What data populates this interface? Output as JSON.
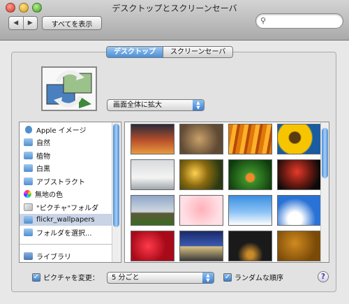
{
  "window": {
    "title": "デスクトップとスクリーンセーバ"
  },
  "toolbar": {
    "back_label": "◀",
    "forward_label": "▶",
    "show_all_label": "すべてを表示",
    "search_placeholder": "",
    "search_icon": "search-icon"
  },
  "tabs": [
    {
      "label": "デスクトップ",
      "active": true
    },
    {
      "label": "スクリーンセーバ",
      "active": false
    }
  ],
  "desktop": {
    "fit_label": "画面全体に拡大",
    "source_list": [
      {
        "label": "Apple イメージ",
        "icon": "apple-icon"
      },
      {
        "label": "自然",
        "icon": "folder-icon"
      },
      {
        "label": "植物",
        "icon": "folder-icon"
      },
      {
        "label": "白黒",
        "icon": "folder-icon"
      },
      {
        "label": "アブストラクト",
        "icon": "folder-icon"
      },
      {
        "label": "無地の色",
        "icon": "colors-icon"
      },
      {
        "label": "\"ピクチャ\"フォルダ",
        "icon": "pictures-folder-icon"
      },
      {
        "label": "flickr_wallpapers",
        "icon": "folder-icon",
        "selected": true
      },
      {
        "label": "フォルダを選択...",
        "icon": "folder-icon"
      }
    ],
    "library_label": "ライブラリ",
    "thumbnails": [
      {
        "name": "sunset-wallpaper",
        "bg": "linear-gradient(#2a2a3a, #b9502a 55%, #e89b40)"
      },
      {
        "name": "bird-wallpaper",
        "bg": "radial-gradient(circle at 45% 50%, #c9a06a, #5f4a34 70%)"
      },
      {
        "name": "orange-rays-wallpaper",
        "bg": "repeating-linear-gradient(100deg, #e0790a 0 6px, #ffb02a 6px 12px, #b34b05 12px 16px)"
      },
      {
        "name": "sunflower-wallpaper",
        "bg": "radial-gradient(circle at 40% 45%, #5a3a10 0 18%, #f7c400 22% 55%, #1a5ca0 60%)"
      },
      {
        "name": "chairs-wallpaper",
        "bg": "linear-gradient(#d8dadb, #f4f4f4 60%, #9fa7ab)"
      },
      {
        "name": "flower-field-wallpaper",
        "bg": "radial-gradient(circle at 35% 45%, #ffd050, #8a6a10 40%, #2b3a12 80%)"
      },
      {
        "name": "green-leaf-wallpaper",
        "bg": "radial-gradient(circle at 50% 60%, #f08a2a 0 14%, #3b8f2a 20%, #0e3a0c 85%)"
      },
      {
        "name": "red-berries-wallpaper",
        "bg": "radial-gradient(circle at 45% 40%, #e63a2a, #6a1a12 45%, #0a0a0a 80%)"
      },
      {
        "name": "stonehenge-wallpaper",
        "bg": "linear-gradient(#8fa6c8, #cfd8e0 55%, #5b5a38 60%, #3b6a22)"
      },
      {
        "name": "pink-pig-wallpaper",
        "bg": "radial-gradient(circle at 50% 45%, #ffb0b8, #ffdfe5 70%)"
      },
      {
        "name": "clouds-wallpaper",
        "bg": "linear-gradient(#3a8fe0, #8ac2f5 55%, #ffffff)"
      },
      {
        "name": "blue-sky-wallpaper",
        "bg": "radial-gradient(circle at 40% 80%, #ffffff 0 20%, #2a72d6 60%)"
      },
      {
        "name": "red-flowers-wallpaper",
        "bg": "radial-gradient(circle at 40% 50%, #ff3a4a, #a80a1a 60%)"
      },
      {
        "name": "road-wallpaper",
        "bg": "linear-gradient(#1a2a6a, #3a5ab0 50%, #d8c080 52%, #3a3a3a)"
      },
      {
        "name": "dark-lights-wallpaper",
        "bg": "radial-gradient(circle at 50% 80%, #c88a2a 0 10%, #1a1a1a 40%)"
      },
      {
        "name": "orange-texture-wallpaper",
        "bg": "radial-gradient(circle at 40% 40%, #d08a20, #7a4a08 70%)"
      }
    ]
  },
  "bottom": {
    "change_picture_label": "ピクチャを変更：",
    "change_picture_checked": true,
    "interval_value": "5 分ごと",
    "random_order_label": "ランダムな順序",
    "random_order_checked": true,
    "help_label": "?"
  }
}
